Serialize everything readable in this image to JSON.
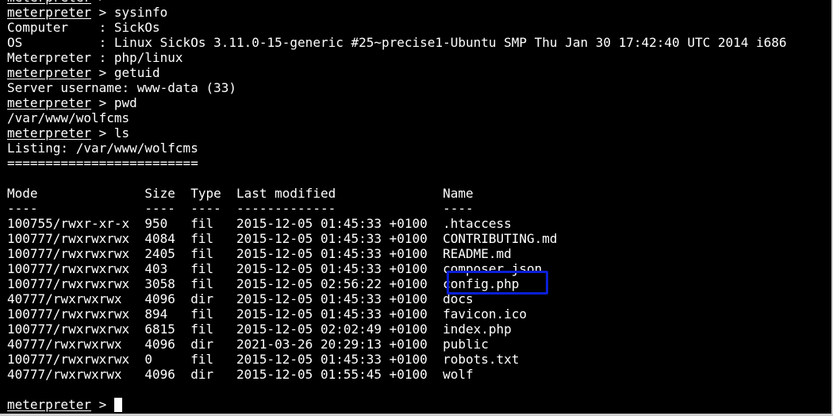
{
  "terminal": {
    "prompt": "meterpreter",
    "prompt_suffix": " > ",
    "lines": [
      {
        "prompt": true,
        "cmd": ""
      },
      {
        "prompt": true,
        "cmd": "sysinfo"
      },
      {
        "text": "Computer    : SickOs"
      },
      {
        "text": "OS          : Linux SickOs 3.11.0-15-generic #25~precise1-Ubuntu SMP Thu Jan 30 17:42:40 UTC 2014 i686"
      },
      {
        "text": "Meterpreter : php/linux"
      },
      {
        "prompt": true,
        "cmd": "getuid"
      },
      {
        "text": "Server username: www-data (33)"
      },
      {
        "prompt": true,
        "cmd": "pwd"
      },
      {
        "text": "/var/www/wolfcms"
      },
      {
        "prompt": true,
        "cmd": "ls"
      },
      {
        "text": "Listing: /var/www/wolfcms"
      },
      {
        "text": "========================="
      },
      {
        "text": ""
      },
      {
        "text": "Mode              Size  Type  Last modified              Name"
      },
      {
        "text": "----              ----  ----  -------------              ----"
      },
      {
        "text": "100755/rwxr-xr-x  950   fil   2015-12-05 01:45:33 +0100  .htaccess"
      },
      {
        "text": "100777/rwxrwxrwx  4084  fil   2015-12-05 01:45:33 +0100  CONTRIBUTING.md"
      },
      {
        "text": "100777/rwxrwxrwx  2405  fil   2015-12-05 01:45:33 +0100  README.md"
      },
      {
        "text": "100777/rwxrwxrwx  403   fil   2015-12-05 01:45:33 +0100  composer.json"
      },
      {
        "text": "100777/rwxrwxrwx  3058  fil   2015-12-05 02:56:22 +0100  config.php"
      },
      {
        "text": "40777/rwxrwxrwx   4096  dir   2015-12-05 01:45:33 +0100  docs"
      },
      {
        "text": "100777/rwxrwxrwx  894   fil   2015-12-05 01:45:33 +0100  favicon.ico"
      },
      {
        "text": "100777/rwxrwxrwx  6815  fil   2015-12-05 02:02:49 +0100  index.php"
      },
      {
        "text": "40777/rwxrwxrwx   4096  dir   2021-03-26 20:29:13 +0100  public"
      },
      {
        "text": "100777/rwxrwxrwx  0     fil   2015-12-05 01:45:33 +0100  robots.txt"
      },
      {
        "text": "40777/rwxrwxrwx   4096  dir   2015-12-05 01:55:45 +0100  wolf"
      },
      {
        "text": ""
      },
      {
        "prompt": true,
        "cmd": "",
        "cursor": true
      }
    ]
  },
  "highlight": {
    "target": "config.php",
    "color": "#0a1fd6"
  }
}
